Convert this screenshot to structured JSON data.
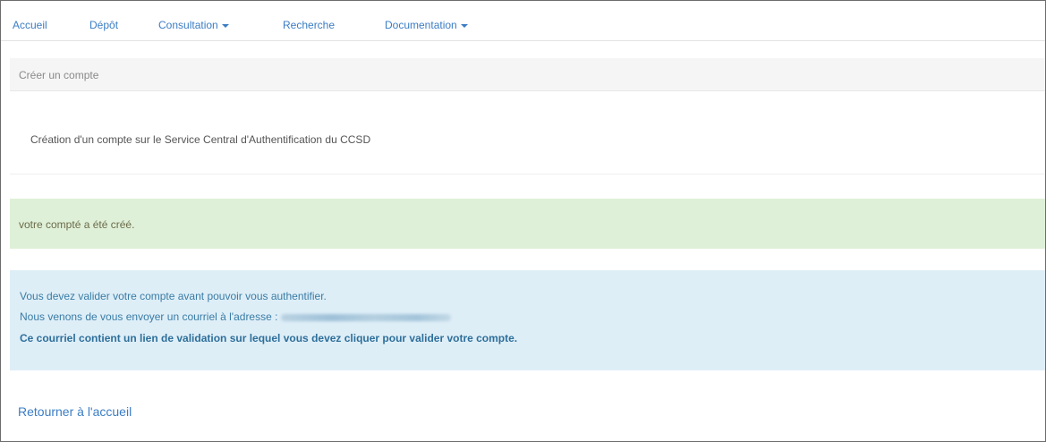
{
  "navbar": {
    "items": [
      {
        "label": "Accueil",
        "has_dropdown": false
      },
      {
        "label": "Dépôt",
        "has_dropdown": false
      },
      {
        "label": "Consultation",
        "has_dropdown": true
      },
      {
        "label": "Recherche",
        "has_dropdown": false
      },
      {
        "label": "Documentation",
        "has_dropdown": true
      }
    ]
  },
  "panel": {
    "heading": "Créer un compte",
    "body": "Création d'un compte sur le Service Central d'Authentification du CCSD"
  },
  "alert_success": {
    "text": "votre compté a été créé."
  },
  "alert_info": {
    "line1": "Vous devez valider votre compte avant pouvoir vous authentifier.",
    "line2": "Nous venons de vous envoyer un courriel à l'adresse :",
    "line3": "Ce courriel contient un lien de validation sur lequel vous devez cliquer pour valider votre compte."
  },
  "return_link": "Retourner à l'accueil",
  "colors": {
    "link": "#3b7dc4",
    "success_bg": "#dff0d8",
    "info_bg": "#deeef7",
    "info_text": "#3a7ca5"
  },
  "icons": {
    "dropdown": "caret-down-icon"
  }
}
